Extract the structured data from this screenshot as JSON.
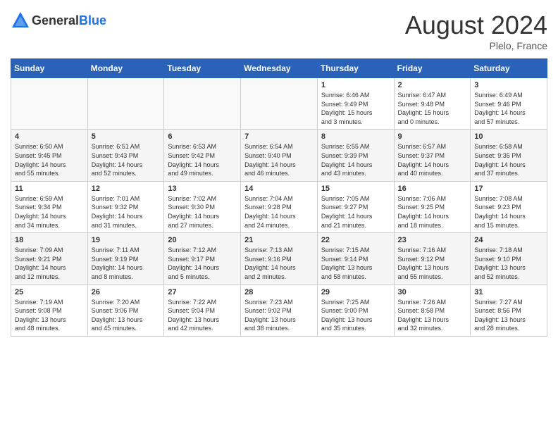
{
  "header": {
    "logo_general": "General",
    "logo_blue": "Blue",
    "month": "August 2024",
    "location": "Plelo, France"
  },
  "weekdays": [
    "Sunday",
    "Monday",
    "Tuesday",
    "Wednesday",
    "Thursday",
    "Friday",
    "Saturday"
  ],
  "weeks": [
    [
      {
        "day": "",
        "info": ""
      },
      {
        "day": "",
        "info": ""
      },
      {
        "day": "",
        "info": ""
      },
      {
        "day": "",
        "info": ""
      },
      {
        "day": "1",
        "info": "Sunrise: 6:46 AM\nSunset: 9:49 PM\nDaylight: 15 hours\nand 3 minutes."
      },
      {
        "day": "2",
        "info": "Sunrise: 6:47 AM\nSunset: 9:48 PM\nDaylight: 15 hours\nand 0 minutes."
      },
      {
        "day": "3",
        "info": "Sunrise: 6:49 AM\nSunset: 9:46 PM\nDaylight: 14 hours\nand 57 minutes."
      }
    ],
    [
      {
        "day": "4",
        "info": "Sunrise: 6:50 AM\nSunset: 9:45 PM\nDaylight: 14 hours\nand 55 minutes."
      },
      {
        "day": "5",
        "info": "Sunrise: 6:51 AM\nSunset: 9:43 PM\nDaylight: 14 hours\nand 52 minutes."
      },
      {
        "day": "6",
        "info": "Sunrise: 6:53 AM\nSunset: 9:42 PM\nDaylight: 14 hours\nand 49 minutes."
      },
      {
        "day": "7",
        "info": "Sunrise: 6:54 AM\nSunset: 9:40 PM\nDaylight: 14 hours\nand 46 minutes."
      },
      {
        "day": "8",
        "info": "Sunrise: 6:55 AM\nSunset: 9:39 PM\nDaylight: 14 hours\nand 43 minutes."
      },
      {
        "day": "9",
        "info": "Sunrise: 6:57 AM\nSunset: 9:37 PM\nDaylight: 14 hours\nand 40 minutes."
      },
      {
        "day": "10",
        "info": "Sunrise: 6:58 AM\nSunset: 9:35 PM\nDaylight: 14 hours\nand 37 minutes."
      }
    ],
    [
      {
        "day": "11",
        "info": "Sunrise: 6:59 AM\nSunset: 9:34 PM\nDaylight: 14 hours\nand 34 minutes."
      },
      {
        "day": "12",
        "info": "Sunrise: 7:01 AM\nSunset: 9:32 PM\nDaylight: 14 hours\nand 31 minutes."
      },
      {
        "day": "13",
        "info": "Sunrise: 7:02 AM\nSunset: 9:30 PM\nDaylight: 14 hours\nand 27 minutes."
      },
      {
        "day": "14",
        "info": "Sunrise: 7:04 AM\nSunset: 9:28 PM\nDaylight: 14 hours\nand 24 minutes."
      },
      {
        "day": "15",
        "info": "Sunrise: 7:05 AM\nSunset: 9:27 PM\nDaylight: 14 hours\nand 21 minutes."
      },
      {
        "day": "16",
        "info": "Sunrise: 7:06 AM\nSunset: 9:25 PM\nDaylight: 14 hours\nand 18 minutes."
      },
      {
        "day": "17",
        "info": "Sunrise: 7:08 AM\nSunset: 9:23 PM\nDaylight: 14 hours\nand 15 minutes."
      }
    ],
    [
      {
        "day": "18",
        "info": "Sunrise: 7:09 AM\nSunset: 9:21 PM\nDaylight: 14 hours\nand 12 minutes."
      },
      {
        "day": "19",
        "info": "Sunrise: 7:11 AM\nSunset: 9:19 PM\nDaylight: 14 hours\nand 8 minutes."
      },
      {
        "day": "20",
        "info": "Sunrise: 7:12 AM\nSunset: 9:17 PM\nDaylight: 14 hours\nand 5 minutes."
      },
      {
        "day": "21",
        "info": "Sunrise: 7:13 AM\nSunset: 9:16 PM\nDaylight: 14 hours\nand 2 minutes."
      },
      {
        "day": "22",
        "info": "Sunrise: 7:15 AM\nSunset: 9:14 PM\nDaylight: 13 hours\nand 58 minutes."
      },
      {
        "day": "23",
        "info": "Sunrise: 7:16 AM\nSunset: 9:12 PM\nDaylight: 13 hours\nand 55 minutes."
      },
      {
        "day": "24",
        "info": "Sunrise: 7:18 AM\nSunset: 9:10 PM\nDaylight: 13 hours\nand 52 minutes."
      }
    ],
    [
      {
        "day": "25",
        "info": "Sunrise: 7:19 AM\nSunset: 9:08 PM\nDaylight: 13 hours\nand 48 minutes."
      },
      {
        "day": "26",
        "info": "Sunrise: 7:20 AM\nSunset: 9:06 PM\nDaylight: 13 hours\nand 45 minutes."
      },
      {
        "day": "27",
        "info": "Sunrise: 7:22 AM\nSunset: 9:04 PM\nDaylight: 13 hours\nand 42 minutes."
      },
      {
        "day": "28",
        "info": "Sunrise: 7:23 AM\nSunset: 9:02 PM\nDaylight: 13 hours\nand 38 minutes."
      },
      {
        "day": "29",
        "info": "Sunrise: 7:25 AM\nSunset: 9:00 PM\nDaylight: 13 hours\nand 35 minutes."
      },
      {
        "day": "30",
        "info": "Sunrise: 7:26 AM\nSunset: 8:58 PM\nDaylight: 13 hours\nand 32 minutes."
      },
      {
        "day": "31",
        "info": "Sunrise: 7:27 AM\nSunset: 8:56 PM\nDaylight: 13 hours\nand 28 minutes."
      }
    ]
  ]
}
